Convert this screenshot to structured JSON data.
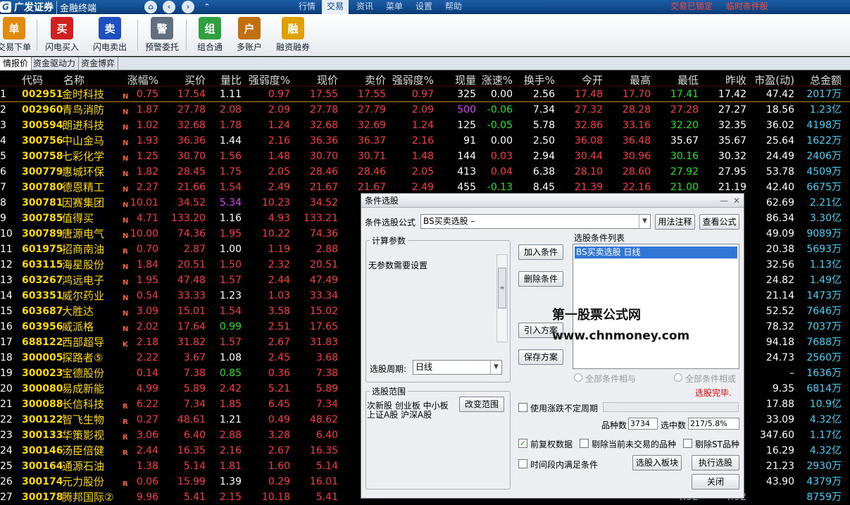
{
  "topbar": {
    "brand": "广发证券",
    "product": "金融终端",
    "menus": [
      "行情",
      "交易",
      "资讯",
      "菜单",
      "设置",
      "帮助"
    ],
    "active_menu": "交易",
    "trade_locked": "交易已锁定",
    "temp_condition": "临时条件股"
  },
  "toolbar": {
    "items": [
      {
        "label": "交易下单",
        "glyph": "单"
      },
      {
        "label": "闪电买入",
        "glyph": "买"
      },
      {
        "label": "闪电卖出",
        "glyph": "卖"
      },
      {
        "label": "预警委托",
        "glyph": "警"
      },
      {
        "label": "组合通",
        "glyph": "组"
      },
      {
        "label": "多账户",
        "glyph": "户"
      },
      {
        "label": "融资融券",
        "glyph": "融"
      }
    ]
  },
  "tabs": [
    "情报价",
    "资金驱动力",
    "资金博弈"
  ],
  "columns": [
    "代码",
    "名称",
    "涨幅%",
    "买价",
    "量比",
    "强弱度%",
    "现价",
    "卖价",
    "强弱度%",
    "现量",
    "涨速%",
    "换手%",
    "今开",
    "最高",
    "最低",
    "昨收",
    "市盈(动)",
    "总金额"
  ],
  "rows": [
    [
      "1",
      "002951",
      "金时科技",
      "N",
      "0.75",
      "17.54",
      "1.11",
      "0.97",
      "17.55",
      "17.55",
      "0.97",
      "325",
      "0.00",
      "2.56",
      "17.48",
      "17.70",
      "17.41",
      "17.42",
      "47.42",
      "2017万"
    ],
    [
      "2",
      "002960",
      "青鸟消防",
      "N",
      "1.87",
      "27.78",
      "2.08",
      "2.09",
      "27.78",
      "27.79",
      "2.09",
      "500",
      "-0.06",
      "7.34",
      "27.32",
      "28.28",
      "27.28",
      "27.27",
      "18.56",
      "1.23亿"
    ],
    [
      "3",
      "300594",
      "朗进科技",
      "N",
      "1.02",
      "32.68",
      "1.78",
      "1.24",
      "32.68",
      "32.69",
      "1.24",
      "125",
      "-0.05",
      "5.78",
      "32.86",
      "33.16",
      "32.20",
      "32.35",
      "36.02",
      "4198万"
    ],
    [
      "4",
      "300756",
      "中山金马",
      "N",
      "1.93",
      "36.36",
      "1.44",
      "2.16",
      "36.36",
      "36.37",
      "2.16",
      "91",
      "0.00",
      "2.50",
      "36.08",
      "36.48",
      "35.67",
      "35.67",
      "25.64",
      "1622万"
    ],
    [
      "5",
      "300758",
      "七彩化学",
      "N",
      "1.25",
      "30.70",
      "1.56",
      "1.48",
      "30.70",
      "30.71",
      "1.48",
      "144",
      "0.03",
      "2.94",
      "30.44",
      "30.96",
      "30.16",
      "30.32",
      "24.49",
      "2406万"
    ],
    [
      "6",
      "300779",
      "惠城环保",
      "N",
      "1.82",
      "28.45",
      "1.75",
      "2.05",
      "28.46",
      "28.46",
      "2.05",
      "413",
      "0.04",
      "6.38",
      "28.10",
      "28.60",
      "27.92",
      "27.95",
      "53.78",
      "4509万"
    ],
    [
      "7",
      "300780",
      "德恩精工",
      "N",
      "2.27",
      "21.66",
      "1.54",
      "2.49",
      "21.67",
      "21.67",
      "2.49",
      "455",
      "-0.13",
      "8.45",
      "21.39",
      "22.16",
      "21.00",
      "21.19",
      "42.40",
      "6675万"
    ],
    [
      "8",
      "300781",
      "因赛集团",
      "N",
      "10.01",
      "34.52",
      "5.34",
      "10.23",
      "34.52",
      "",
      "",
      "",
      "",
      "",
      "",
      "",
      "",
      "",
      "62.69",
      "2.21亿"
    ],
    [
      "9",
      "300785",
      "值得买",
      "N",
      "4.71",
      "133.20",
      "1.16",
      "4.93",
      "133.21",
      "",
      "",
      "",
      "",
      "",
      "",
      "",
      "",
      "",
      "86.34",
      "3.30亿"
    ],
    [
      "10",
      "300789",
      "唐源电气",
      "N",
      "10.00",
      "74.36",
      "1.95",
      "10.22",
      "74.36",
      "",
      "",
      "",
      "",
      "",
      "",
      "",
      "",
      "",
      "49.09",
      "9089万"
    ],
    [
      "11",
      "601975",
      "招商南油",
      "R",
      "0.70",
      "2.87",
      "1.00",
      "1.19",
      "2.88",
      "",
      "",
      "",
      "",
      "",
      "",
      "",
      "",
      "",
      "20.38",
      "5693万"
    ],
    [
      "12",
      "603115",
      "海星股份",
      "N",
      "1.84",
      "20.51",
      "1.50",
      "2.32",
      "20.51",
      "",
      "",
      "",
      "",
      "",
      "",
      "",
      "",
      "",
      "32.56",
      "1.13亿"
    ],
    [
      "13",
      "603267",
      "鸿远电子",
      "N",
      "1.95",
      "47.48",
      "1.57",
      "2.44",
      "47.49",
      "",
      "",
      "",
      "",
      "",
      "",
      "",
      "",
      "",
      "24.82",
      "1.49亿"
    ],
    [
      "14",
      "603351",
      "威尔药业",
      "N",
      "0.54",
      "33.33",
      "1.23",
      "1.03",
      "33.34",
      "",
      "",
      "",
      "",
      "",
      "",
      "",
      "",
      "",
      "21.14",
      "1473万"
    ],
    [
      "15",
      "603687",
      "大胜达",
      "N",
      "3.09",
      "15.01",
      "1.54",
      "3.58",
      "15.02",
      "",
      "",
      "",
      "",
      "",
      "",
      "",
      "",
      "",
      "52.52",
      "7646万"
    ],
    [
      "16",
      "603956",
      "威派格",
      "N",
      "2.02",
      "17.64",
      "0.99",
      "2.51",
      "17.65",
      "",
      "",
      "",
      "",
      "",
      "",
      "",
      "",
      "",
      "78.32",
      "7037万"
    ],
    [
      "17",
      "688122",
      "西部超导",
      "K",
      "2.18",
      "31.82",
      "1.57",
      "2.67",
      "31.83",
      "",
      "",
      "",
      "",
      "",
      "",
      "",
      "",
      "",
      "94.18",
      "7688万"
    ],
    [
      "18",
      "300005",
      "探路者⑤",
      "",
      "2.22",
      "3.67",
      "1.08",
      "2.45",
      "3.68",
      "",
      "",
      "",
      "",
      "",
      "",
      "",
      "",
      "",
      "24.73",
      "2560万"
    ],
    [
      "19",
      "300023",
      "宝德股份",
      "",
      "0.14",
      "7.38",
      "0.85",
      "0.36",
      "7.38",
      "",
      "",
      "",
      "",
      "",
      "",
      "",
      "",
      "",
      "–",
      "1636万"
    ],
    [
      "20",
      "300080",
      "易成新能",
      "",
      "4.99",
      "5.89",
      "2.42",
      "5.21",
      "5.89",
      "",
      "",
      "",
      "",
      "",
      "",
      "",
      "",
      "",
      "9.35",
      "6814万"
    ],
    [
      "21",
      "300088",
      "长信科技",
      "R",
      "6.22",
      "7.34",
      "1.85",
      "6.45",
      "7.34",
      "",
      "",
      "",
      "",
      "",
      "",
      "",
      "",
      "",
      "17.88",
      "10.9亿"
    ],
    [
      "22",
      "300122",
      "智飞生物",
      "R",
      "0.27",
      "48.61",
      "1.21",
      "0.49",
      "48.62",
      "",
      "",
      "",
      "",
      "",
      "",
      "",
      "",
      "",
      "33.09",
      "4.32亿"
    ],
    [
      "23",
      "300133",
      "华策影视",
      "R",
      "3.06",
      "6.40",
      "2.88",
      "3.28",
      "6.40",
      "",
      "",
      "",
      "",
      "",
      "",
      "",
      "",
      "",
      "347.60",
      "1.17亿"
    ],
    [
      "24",
      "300146",
      "汤臣倍健",
      "R",
      "2.44",
      "16.35",
      "2.16",
      "2.67",
      "16.35",
      "",
      "",
      "",
      "",
      "",
      "",
      "",
      "",
      "",
      "16.29",
      "4.32亿"
    ],
    [
      "25",
      "300164",
      "通源石油",
      "",
      "1.38",
      "5.14",
      "1.81",
      "1.60",
      "5.14",
      "",
      "",
      "",
      "",
      "",
      "",
      "",
      "",
      "",
      "21.23",
      "2930万"
    ],
    [
      "26",
      "300174",
      "元力股份",
      "R",
      "0.06",
      "15.99",
      "1.39",
      "0.29",
      "16.01",
      "",
      "",
      "",
      "",
      "",
      "",
      "",
      "",
      "",
      "43.90",
      "4379万"
    ],
    [
      "27",
      "300178",
      "腾邦国际②",
      "",
      "9.96",
      "5.41",
      "2.15",
      "10.18",
      "5.41",
      "",
      "",
      "",
      "",
      "",
      "",
      "",
      "4.92",
      "4.92",
      "",
      "8759万"
    ]
  ],
  "dialog": {
    "title": "条件选股",
    "formula_label": "条件选股公式",
    "formula_value": "BS买卖选股  –",
    "btn_usage": "用法注释",
    "btn_view": "查看公式",
    "calc_params_title": "计算参数",
    "no_params": "无参数需要设置",
    "period_label": "选股周期:",
    "period_value": "日线",
    "btn_add": "加入条件",
    "btn_delete": "删除条件",
    "btn_import": "引入方案",
    "btn_save": "保存方案",
    "list_title": "选股条件列表",
    "list_item": "BS买卖选股  日线",
    "radio_and": "全部条件相与",
    "radio_or": "全部条件相或",
    "status": "选股完毕.",
    "scope_title": "选股范围",
    "scope_text1": "次新股 创业板 中小板",
    "scope_text2": "上证A股 沪深A股",
    "btn_scope": "改变范围",
    "uncertain_cycle": "使用涨跌不定周期",
    "count_label": "品种数",
    "count_value": "3734",
    "selected_label": "选中数",
    "selected_value": "217/5.8%",
    "fq_data": "前复权数据",
    "exclude_untraded": "剔除当前未交易的品种",
    "exclude_st": "剔除ST品种",
    "period_satisfy": "时间段内满足条件",
    "btn_to_block": "选股入板块",
    "btn_exec": "执行选股",
    "btn_close": "关闭"
  },
  "watermark": {
    "line1": "第一股票公式网",
    "line2": "www.chnmoney.com"
  },
  "colors": {
    "up": "#ff3b3b",
    "down": "#1ee61e",
    "code": "#ffd800",
    "amount": "#3fd4ff"
  }
}
